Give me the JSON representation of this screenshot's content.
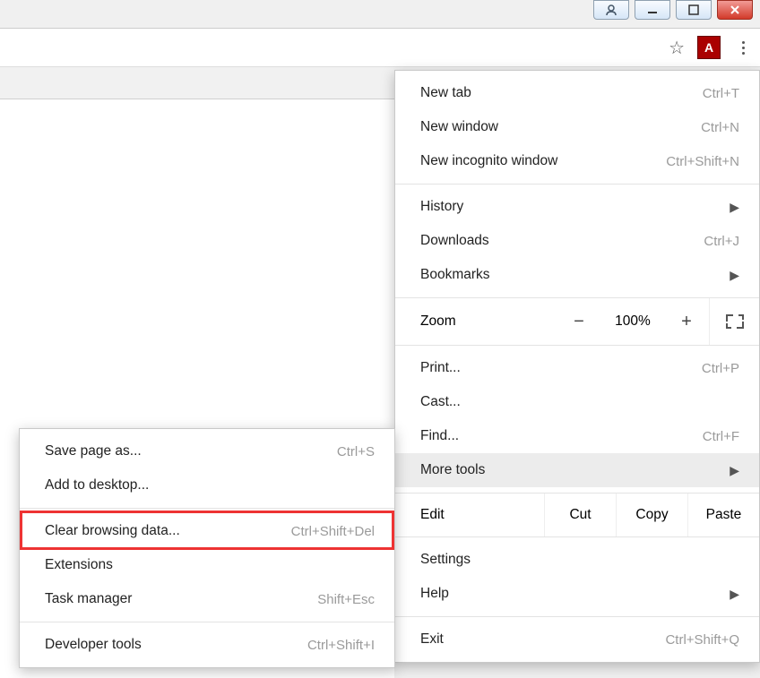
{
  "toolbar": {
    "star": "☆",
    "extension_letter": "A"
  },
  "menu": {
    "new_tab": "New tab",
    "new_tab_sc": "Ctrl+T",
    "new_window": "New window",
    "new_window_sc": "Ctrl+N",
    "new_incognito": "New incognito window",
    "new_incognito_sc": "Ctrl+Shift+N",
    "history": "History",
    "downloads": "Downloads",
    "downloads_sc": "Ctrl+J",
    "bookmarks": "Bookmarks",
    "zoom": "Zoom",
    "zoom_minus": "−",
    "zoom_pct": "100%",
    "zoom_plus": "+",
    "print": "Print...",
    "print_sc": "Ctrl+P",
    "cast": "Cast...",
    "find": "Find...",
    "find_sc": "Ctrl+F",
    "more_tools": "More tools",
    "edit": "Edit",
    "cut": "Cut",
    "copy": "Copy",
    "paste": "Paste",
    "settings": "Settings",
    "help": "Help",
    "exit": "Exit",
    "exit_sc": "Ctrl+Shift+Q",
    "arrow": "▶"
  },
  "submenu": {
    "save_page": "Save page as...",
    "save_page_sc": "Ctrl+S",
    "add_desktop": "Add to desktop...",
    "clear_data": "Clear browsing data...",
    "clear_data_sc": "Ctrl+Shift+Del",
    "extensions": "Extensions",
    "task_manager": "Task manager",
    "task_manager_sc": "Shift+Esc",
    "dev_tools": "Developer tools",
    "dev_tools_sc": "Ctrl+Shift+I"
  }
}
